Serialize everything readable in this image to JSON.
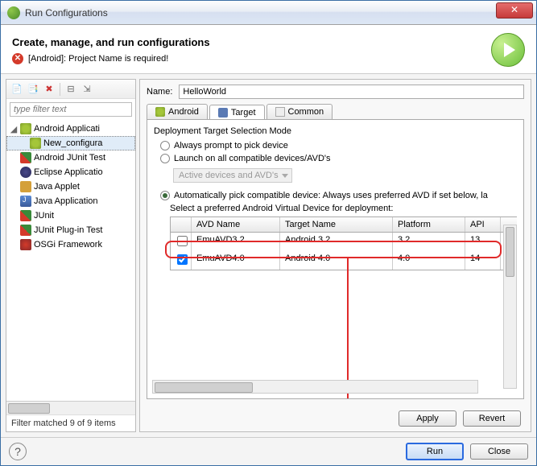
{
  "window": {
    "title": "Run Configurations"
  },
  "header": {
    "title": "Create, manage, and run configurations",
    "error": "[Android]: Project Name is required!"
  },
  "filter": {
    "placeholder": "type filter text"
  },
  "tree": {
    "items": [
      {
        "label": "Android Applicati",
        "icon": "android",
        "expanded": true
      },
      {
        "label": "New_configura",
        "icon": "android",
        "child": true,
        "selected": true
      },
      {
        "label": "Android JUnit Test",
        "icon": "junit"
      },
      {
        "label": "Eclipse Applicatio",
        "icon": "eclipse"
      },
      {
        "label": "Java Applet",
        "icon": "applet"
      },
      {
        "label": "Java Application",
        "icon": "java"
      },
      {
        "label": "JUnit",
        "icon": "junit"
      },
      {
        "label": "JUnit Plug-in Test",
        "icon": "junit"
      },
      {
        "label": "OSGi Framework",
        "icon": "osgi"
      }
    ],
    "status": "Filter matched 9 of 9 items"
  },
  "form": {
    "name_label": "Name:",
    "name_value": "HelloWorld",
    "tabs": {
      "android": "Android",
      "target": "Target",
      "common": "Common"
    },
    "target": {
      "group_title": "Deployment Target Selection Mode",
      "opt_prompt": "Always prompt to pick device",
      "opt_launch": "Launch on all compatible devices/AVD's",
      "combo_label": "Active devices and AVD's",
      "opt_auto": "Automatically pick compatible device: Always uses preferred AVD if set below, la",
      "sub_label": "Select a preferred Android Virtual Device for deployment:",
      "cols": {
        "name": "AVD Name",
        "target": "Target Name",
        "platform": "Platform",
        "api": "API"
      },
      "rows": [
        {
          "checked": false,
          "name": "EmuAVD3.2",
          "target": "Android 3.2",
          "platform": "3.2",
          "api": "13"
        },
        {
          "checked": true,
          "name": "EmuAVD4.0",
          "target": "Android 4.0",
          "platform": "4.0",
          "api": "14"
        }
      ]
    }
  },
  "buttons": {
    "apply": "Apply",
    "revert": "Revert",
    "run": "Run",
    "close": "Close"
  }
}
